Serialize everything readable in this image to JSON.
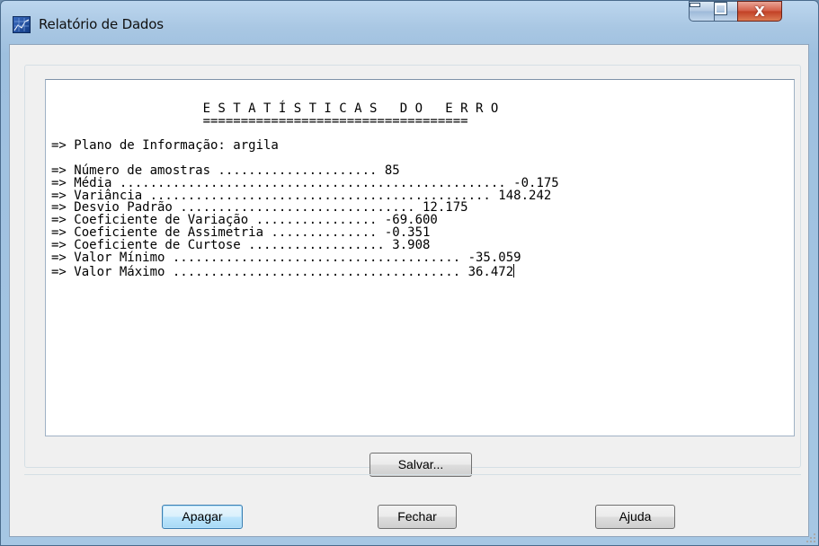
{
  "window": {
    "title": "Relatório de Dados",
    "icon": "grid-map-icon",
    "controls": {
      "minimize": "minimize-icon",
      "maximize": "maximize-icon",
      "close": "X"
    }
  },
  "report": {
    "lines": [
      "                    E S T A T Í S T I C A S   D O   E R R O",
      "                    ===================================",
      "",
      "=> Plano de Informação: argila",
      "",
      "=> Número de amostras ..................... 85",
      "=> Média ................................................... -0.175",
      "=> Variância ............................................. 148.242",
      "=> Desvio Padrão ............................... 12.175",
      "=> Coeficiente de Variação ................ -69.600",
      "=> Coeficiente de Assimetria .............. -0.351",
      "=> Coeficiente de Curtose .................. 3.908",
      "=> Valor Mínimo ...................................... -35.059",
      "=> Valor Máximo ...................................... 36.472"
    ]
  },
  "buttons": {
    "save": "Salvar...",
    "clear": "Apagar",
    "close": "Fechar",
    "help": "Ajuda"
  },
  "colors": {
    "frame": "#a9c7e3",
    "client": "#f0f0f0",
    "default_button": "#bee6fd",
    "close_button": "#c13f25"
  }
}
